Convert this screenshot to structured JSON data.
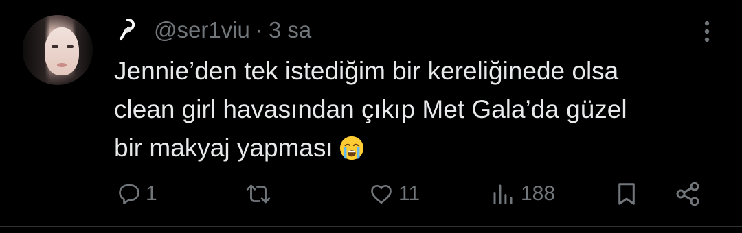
{
  "tweet": {
    "handle": "@ser1viu",
    "separator": "·",
    "time": "3 sa",
    "text_lines": [
      "Jennie’den tek istediğim bir kereliğinede olsa",
      "clean girl havasından çıkıp Met Gala’da güzel",
      "bir makyaj yapması"
    ],
    "emoji": "loudly-crying-face"
  },
  "actions": {
    "reply_count": "1",
    "retweet_count": "",
    "like_count": "11",
    "views_count": "188"
  },
  "colors": {
    "background": "#000000",
    "text": "#e7e9ea",
    "muted": "#71767b",
    "divider": "#2f3336"
  }
}
